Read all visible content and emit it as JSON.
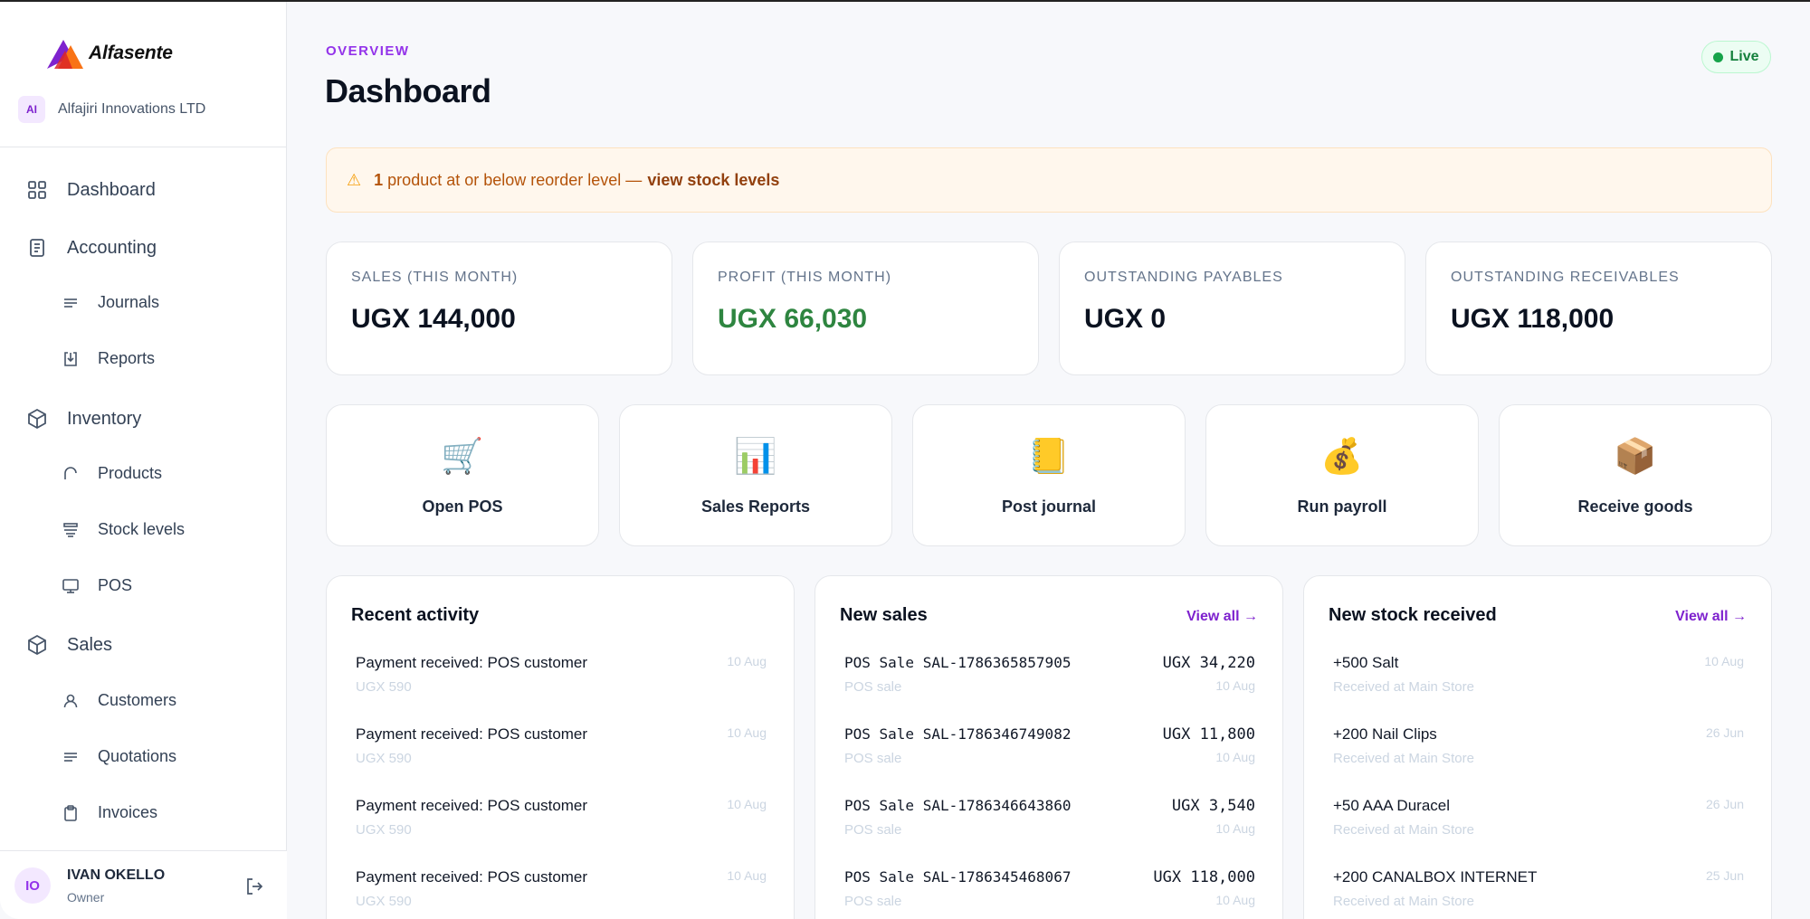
{
  "brand": {
    "name": "Alfasente"
  },
  "org": {
    "initials": "AI",
    "name": "Alfajiri Innovations LTD"
  },
  "sidebar": {
    "items": [
      {
        "label": "Dashboard",
        "icon": "grid-icon"
      },
      {
        "label": "Accounting",
        "icon": "document-icon"
      },
      {
        "label": "Journals",
        "icon": "lines-icon"
      },
      {
        "label": "Reports",
        "icon": "download-box-icon"
      },
      {
        "label": "Inventory",
        "icon": "cube-icon"
      },
      {
        "label": "Products",
        "icon": "arch-icon"
      },
      {
        "label": "Stock levels",
        "icon": "stack-icon"
      },
      {
        "label": "POS",
        "icon": "monitor-icon"
      },
      {
        "label": "Sales",
        "icon": "cube-icon"
      },
      {
        "label": "Customers",
        "icon": "person-icon"
      },
      {
        "label": "Quotations",
        "icon": "lines-icon"
      },
      {
        "label": "Invoices",
        "icon": "clipboard-icon"
      }
    ]
  },
  "user": {
    "initials": "IO",
    "name": "IVAN OKELLO",
    "role": "Owner"
  },
  "header": {
    "eyebrow": "OVERVIEW",
    "title": "Dashboard",
    "status": "Live"
  },
  "alert": {
    "count": "1",
    "text": "product at or below reorder level —",
    "link": "view stock levels"
  },
  "kpis": [
    {
      "label": "SALES (THIS MONTH)",
      "value": "UGX 144,000"
    },
    {
      "label": "PROFIT (THIS MONTH)",
      "value": "UGX 66,030"
    },
    {
      "label": "OUTSTANDING PAYABLES",
      "value": "UGX 0"
    },
    {
      "label": "OUTSTANDING RECEIVABLES",
      "value": "UGX 118,000"
    }
  ],
  "quick_actions": [
    {
      "label": "Open POS",
      "icon": "🛒"
    },
    {
      "label": "Sales Reports",
      "icon": "📊"
    },
    {
      "label": "Post journal",
      "icon": "📒"
    },
    {
      "label": "Run payroll",
      "icon": "💰"
    },
    {
      "label": "Receive goods",
      "icon": "📦"
    }
  ],
  "recent_activity": {
    "title": "Recent activity",
    "rows": [
      {
        "title": "Payment received: POS customer",
        "sub": "UGX 590",
        "date": "10 Aug"
      },
      {
        "title": "Payment received: POS customer",
        "sub": "UGX 590",
        "date": "10 Aug"
      },
      {
        "title": "Payment received: POS customer",
        "sub": "UGX 590",
        "date": "10 Aug"
      },
      {
        "title": "Payment received: POS customer",
        "sub": "UGX 590",
        "date": "10 Aug"
      }
    ]
  },
  "new_sales": {
    "title": "New sales",
    "view_all": "View all →",
    "rows": [
      {
        "title": "POS Sale SAL-1786365857905",
        "sub": "POS sale",
        "amount": "UGX 34,220",
        "date": "10 Aug"
      },
      {
        "title": "POS Sale SAL-1786346749082",
        "sub": "POS sale",
        "amount": "UGX 11,800",
        "date": "10 Aug"
      },
      {
        "title": "POS Sale SAL-1786346643860",
        "sub": "POS sale",
        "amount": "UGX 3,540",
        "date": "10 Aug"
      },
      {
        "title": "POS Sale SAL-1786345468067",
        "sub": "POS sale",
        "amount": "UGX 118,000",
        "date": "10 Aug"
      }
    ]
  },
  "new_stock": {
    "title": "New stock received",
    "view_all": "View all →",
    "rows": [
      {
        "title": "+500 Salt",
        "sub": "Received at Main Store",
        "date": "10 Aug"
      },
      {
        "title": "+200 Nail Clips",
        "sub": "Received at Main Store",
        "date": "26 Jun"
      },
      {
        "title": "+50 AAA Duracel",
        "sub": "Received at Main Store",
        "date": "26 Jun"
      },
      {
        "title": "+200 CANALBOX INTERNET",
        "sub": "Received at Main Store",
        "date": "25 Jun"
      }
    ]
  },
  "colors": {
    "accent": "#9333ea",
    "profit": "#2e8540",
    "alert_bg": "#fff7ed",
    "live": "#16a34a"
  }
}
